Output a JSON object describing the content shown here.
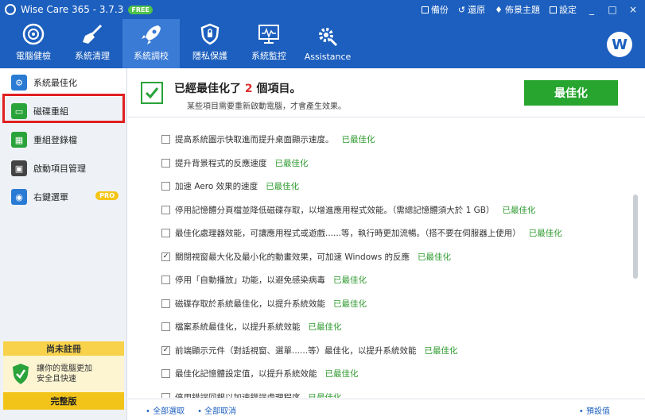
{
  "titlebar": {
    "app_title": "Wise Care 365 - 3.7.3",
    "badge": "FREE",
    "backup": "備份",
    "restore": "還原",
    "theme": "佈景主題",
    "settings": "設定",
    "minimize": "_",
    "maximize": "□",
    "close": "×"
  },
  "toolbar": {
    "items": [
      {
        "label": "電腦健檢",
        "icon": "gauge-icon"
      },
      {
        "label": "系統清理",
        "icon": "broom-icon"
      },
      {
        "label": "系統調校",
        "icon": "rocket-icon"
      },
      {
        "label": "隱私保護",
        "icon": "shield-icon"
      },
      {
        "label": "系統監控",
        "icon": "monitor-icon"
      },
      {
        "label": "Assistance",
        "icon": "gear-wrench-icon"
      }
    ],
    "active_index": 2,
    "avatar": "W"
  },
  "sidebar": {
    "items": [
      {
        "label": "系統最佳化",
        "icon": "optimize-icon",
        "color": "#2a7bd3"
      },
      {
        "label": "磁碟重組",
        "icon": "disk-icon",
        "color": "#2aa33a"
      },
      {
        "label": "重組登錄檔",
        "icon": "registry-icon",
        "color": "#2aa33a"
      },
      {
        "label": "啟動項目管理",
        "icon": "startup-icon",
        "color": "#444444"
      },
      {
        "label": "右鍵選單",
        "icon": "mouse-icon",
        "color": "#2a7bd3",
        "badge": "PRO"
      }
    ],
    "unregistered_title": "尚未註冊",
    "unregistered_msg_1": "讓你的電腦更加",
    "unregistered_msg_2": "安全且快速",
    "full_version_button": "完整版"
  },
  "header": {
    "title_prefix": "已經最佳化了",
    "count": "2",
    "title_suffix": "個項目。",
    "subtitle": "某些項目需要重新啟動電腦，才會產生效果。",
    "optimize_button": "最佳化"
  },
  "options": {
    "status_label": "已最佳化",
    "items": [
      {
        "text": "提高系統圖示快取進而提升桌面顯示速度。",
        "checked": false
      },
      {
        "text": "提升背景程式的反應速度",
        "checked": false
      },
      {
        "text": "加速 Aero 效果的速度",
        "checked": false
      },
      {
        "text": "停用記憶體分頁檔並降低磁碟存取，以增進應用程式效能。（需總記憶體須大於 1 GB）",
        "checked": false
      },
      {
        "text": "最佳化處理器效能，可讓應用程式或遊戲......等，執行時更加流暢。（搭不要在伺服器上使用）",
        "checked": false
      },
      {
        "text": "關閉視窗最大化及最小化的動畫效果，可加速 Windows 的反應",
        "checked": true
      },
      {
        "text": "停用「自動播放」功能，以避免感染病毒",
        "checked": false
      },
      {
        "text": "磁碟存取於系統最佳化，以提升系統效能",
        "checked": false
      },
      {
        "text": "檔案系統最佳化，以提升系統效能",
        "checked": false
      },
      {
        "text": "前端顯示元件（對話視窗、選單......等）最佳化，以提升系統效能",
        "checked": true
      },
      {
        "text": "最佳化記憶體設定值，以提升系統效能",
        "checked": false
      },
      {
        "text": "停用錯誤回報以加速錯誤處理程序",
        "checked": false
      }
    ]
  },
  "footer": {
    "select_all": "全部選取",
    "deselect_all": "全部取消",
    "default": "預設值"
  }
}
